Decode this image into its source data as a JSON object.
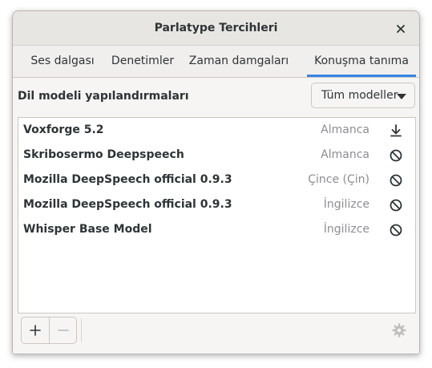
{
  "window": {
    "title": "Parlatype Tercihleri"
  },
  "tabs": [
    {
      "label": "Ses dalgası",
      "active": false
    },
    {
      "label": "Denetimler",
      "active": false
    },
    {
      "label": "Zaman damgaları",
      "active": false
    },
    {
      "label": "Konuşma tanıma",
      "active": true
    }
  ],
  "section": {
    "label": "Dil modeli yapılandırmaları"
  },
  "filter": {
    "selected": "Tüm modeller"
  },
  "models": [
    {
      "name": "Voxforge 5.2",
      "language": "Almanca",
      "action_icon": "download-icon"
    },
    {
      "name": "Skribosermo Deepspeech",
      "language": "Almanca",
      "action_icon": "unavailable-icon"
    },
    {
      "name": "Mozilla DeepSpeech official 0.9.3",
      "language": "Çince (Çin)",
      "action_icon": "unavailable-icon"
    },
    {
      "name": "Mozilla DeepSpeech official 0.9.3",
      "language": "İngilizce",
      "action_icon": "unavailable-icon"
    },
    {
      "name": "Whisper Base Model",
      "language": "İngilizce",
      "action_icon": "unavailable-icon"
    }
  ],
  "colors": {
    "accent": "#3584e4",
    "text": "#2e3436",
    "dim": "#8b8e8f"
  }
}
